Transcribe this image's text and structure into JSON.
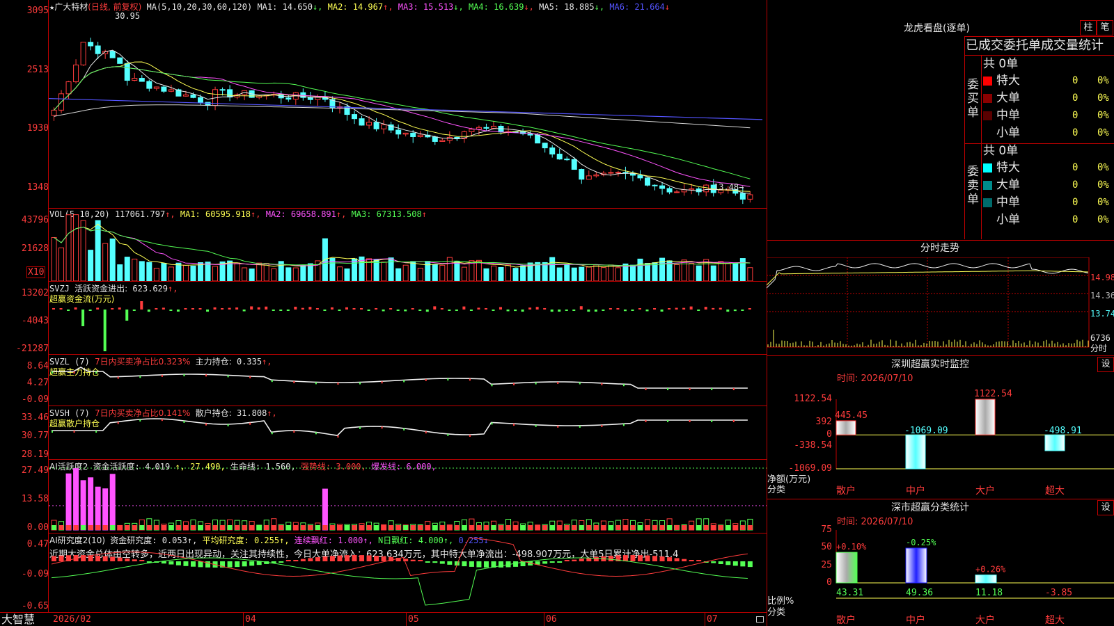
{
  "stock": {
    "name": "广大特材",
    "period": "日线, 前复权",
    "star": "★"
  },
  "main": {
    "ma_header": "MA(5,10,20,30,60,120)",
    "ma": [
      {
        "label": "MA1:",
        "value": "14.650",
        "arrow": "↓",
        "color": "#e6e6e6"
      },
      {
        "label": "MA2:",
        "value": "14.967",
        "arrow": "↑",
        "color": "#ffff54"
      },
      {
        "label": "MA3:",
        "value": "15.513",
        "arrow": "↓",
        "color": "#ff54ff"
      },
      {
        "label": "MA4:",
        "value": "16.639",
        "arrow": "↓",
        "color": "#54ff54"
      },
      {
        "label": "MA5:",
        "value": "18.885",
        "arrow": "↓",
        "color": "#e6e6e6"
      },
      {
        "label": "MA6:",
        "value": "21.664",
        "arrow": "↓",
        "color": "#5454ff"
      }
    ],
    "y_labels": [
      "3095",
      "2513",
      "1930",
      "1348"
    ],
    "high_mark": "30.95",
    "low_mark": "13.48→"
  },
  "vol": {
    "header": "VOL(5,10,20)",
    "value": "117061.797",
    "ma": [
      {
        "label": "MA1:",
        "value": "60595.918",
        "arrow": "↑",
        "color": "#ffff54"
      },
      {
        "label": "MA2:",
        "value": "69658.891",
        "arrow": "↑",
        "color": "#ff54ff"
      },
      {
        "label": "MA3:",
        "value": "67313.508",
        "arrow": "↑",
        "color": "#54ff54"
      }
    ],
    "y_labels": [
      "43796",
      "21628"
    ],
    "unit": "X10"
  },
  "svzj": {
    "header": "SVZJ",
    "text": "活跃资金进出:",
    "value": "623.629",
    "arrow": "↑,",
    "sub": "超赢资金流(万元)",
    "y_labels": [
      "13202",
      "-4043",
      "-21287"
    ]
  },
  "svzl": {
    "header": "SVZL (7)",
    "text1": "7日内买卖净占比0.323%",
    "text2": "主力持仓:",
    "value": "0.335",
    "arrow": "↑,",
    "sub": "超赢主力持仓",
    "y_labels": [
      "8.64",
      "4.27",
      "-0.09"
    ]
  },
  "svsh": {
    "header": "SVSH (7)",
    "text1": "7日内买卖净占比0.141%",
    "text2": "散户持仓:",
    "value": "31.808",
    "arrow": "↑,",
    "sub": "超赢散户持仓",
    "y_labels": [
      "33.46",
      "30.77",
      "28.19"
    ]
  },
  "ai1": {
    "header": "AI活跃度2",
    "items": [
      {
        "text": "资金活跃度: 4.019",
        "color": "#e6e6e6"
      },
      {
        "text": "↑, 27.490,",
        "color": "#ffff54"
      },
      {
        "text": "生命线: 1.560,",
        "color": "#e6e6e6"
      },
      {
        "text": "强势线: 3.000,",
        "color": "#ff3c3c"
      },
      {
        "text": "爆发线: 6.000,",
        "color": "#ff54ff"
      }
    ],
    "y_labels": [
      "27.49",
      "13.58",
      "0.00"
    ]
  },
  "ai2": {
    "header": "AI研究度2(10)",
    "items": [
      {
        "text": "资金研究度: 0.053↑,",
        "color": "#e6e6e6"
      },
      {
        "text": "平均研究度: 0.255↑,",
        "color": "#ffff54"
      },
      {
        "text": "连续飘红: 1.000↑,",
        "color": "#ff54ff"
      },
      {
        "text": "N日飘红: 4.000↑,",
        "color": "#54ff54"
      },
      {
        "text": "0.255↓",
        "color": "#5454ff"
      }
    ],
    "comment": "近期大资金总体由空转多，近两日出现异动，关注其持续性，今日大单净流入：623.634万元，其中特大单净流出：-498.907万元，大单5日累计净出-511.4",
    "y_labels": [
      "0.47",
      "-0.09",
      "-0.65"
    ]
  },
  "xaxis": {
    "brand": "大智慧",
    "labels": [
      "2026/02",
      "04",
      "05",
      "06",
      "07"
    ]
  },
  "dragon": {
    "title": "龙虎看盘(逐单)",
    "btn1": "柱",
    "btn2": "笔",
    "subtitle": "已成交委托单成交量统计",
    "buy": {
      "label": "委买单",
      "total": "共 0单",
      "rows": [
        {
          "name": "特大",
          "color": "#ff0000",
          "val": "0",
          "pct": "0%"
        },
        {
          "name": "大单",
          "color": "#8b0000",
          "val": "0",
          "pct": "0%"
        },
        {
          "name": "中单",
          "color": "#5a0000",
          "val": "0",
          "pct": "0%"
        },
        {
          "name": "小单",
          "color": "",
          "val": "0",
          "pct": "0%"
        }
      ]
    },
    "sell": {
      "label": "委卖单",
      "total": "共 0单",
      "rows": [
        {
          "name": "特大",
          "color": "#00ffff",
          "val": "0",
          "pct": "0%"
        },
        {
          "name": "大单",
          "color": "#008b8b",
          "val": "0",
          "pct": "0%"
        },
        {
          "name": "中单",
          "color": "#006b6b",
          "val": "0",
          "pct": "0%"
        },
        {
          "name": "小单",
          "color": "",
          "val": "0",
          "pct": "0%"
        }
      ]
    }
  },
  "intraday": {
    "title": "分时走势",
    "labels": [
      "14.98",
      "14.36",
      "13.74",
      "6736",
      "分时"
    ]
  },
  "monitor": {
    "title": "深圳超赢实时监控",
    "btn": "设",
    "time": "时间: 2026/07/10",
    "y_labels": [
      "1122.54",
      "392",
      "0",
      "-338.54",
      "-1069.09"
    ],
    "axis_title": "净额(万元)",
    "axis_sub": "分类",
    "cats": [
      "散户",
      "中户",
      "大户",
      "超大"
    ],
    "values": [
      445.45,
      -1069.09,
      1122.54,
      -498.91
    ],
    "value_labels": [
      "445.45",
      "-1069.09",
      "1122.54",
      "-498.91"
    ]
  },
  "classify": {
    "title": "深市超赢分类统计",
    "btn": "设",
    "time": "时间: 2026/07/10",
    "y_labels": [
      "75",
      "50",
      "25",
      "0"
    ],
    "axis_title": "比例%",
    "axis_sub": "分类",
    "cats": [
      "散户",
      "中户",
      "大户",
      "超大"
    ],
    "values": [
      43.31,
      49.36,
      11.18,
      -3.85
    ],
    "value_labels": [
      "43.31",
      "49.36",
      "11.18",
      "-3.85"
    ],
    "change_labels": [
      "+0.10%",
      "-0.25%",
      "+0.26%",
      ""
    ]
  }
}
